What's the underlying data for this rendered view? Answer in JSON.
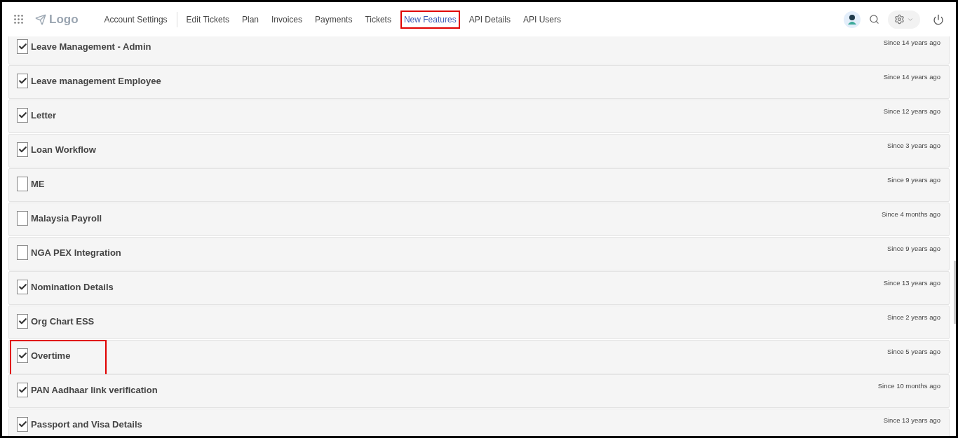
{
  "header": {
    "logo": "Logo",
    "nav": [
      {
        "label": "Account Settings",
        "selected": false,
        "highlighted": false
      },
      {
        "label": "Edit Tickets",
        "selected": false,
        "highlighted": false
      },
      {
        "label": "Plan",
        "selected": false,
        "highlighted": false
      },
      {
        "label": "Invoices",
        "selected": false,
        "highlighted": false
      },
      {
        "label": "Payments",
        "selected": false,
        "highlighted": false
      },
      {
        "label": "Tickets",
        "selected": false,
        "highlighted": false
      },
      {
        "label": "New Features",
        "selected": true,
        "highlighted": true
      },
      {
        "label": "API Details",
        "selected": false,
        "highlighted": false
      },
      {
        "label": "API Users",
        "selected": false,
        "highlighted": false
      }
    ]
  },
  "features": [
    {
      "name": "Leave Management - Admin",
      "since": "Since 14 years ago",
      "checked": true,
      "highlighted": false
    },
    {
      "name": "Leave management Employee",
      "since": "Since 14 years ago",
      "checked": true,
      "highlighted": false
    },
    {
      "name": "Letter",
      "since": "Since 12 years ago",
      "checked": true,
      "highlighted": false
    },
    {
      "name": "Loan Workflow",
      "since": "Since 3 years ago",
      "checked": true,
      "highlighted": false
    },
    {
      "name": "ME",
      "since": "Since 9 years ago",
      "checked": false,
      "highlighted": false
    },
    {
      "name": "Malaysia Payroll",
      "since": "Since 4 months ago",
      "checked": false,
      "highlighted": false
    },
    {
      "name": "NGA PEX Integration",
      "since": "Since 9 years ago",
      "checked": false,
      "highlighted": false
    },
    {
      "name": "Nomination Details",
      "since": "Since 13 years ago",
      "checked": true,
      "highlighted": false
    },
    {
      "name": "Org Chart ESS",
      "since": "Since 2 years ago",
      "checked": true,
      "highlighted": false
    },
    {
      "name": "Overtime",
      "since": "Since 5 years ago",
      "checked": true,
      "highlighted": true
    },
    {
      "name": "PAN Aadhaar link verification",
      "since": "Since 10 months ago",
      "checked": true,
      "highlighted": false
    },
    {
      "name": "Passport and Visa Details",
      "since": "Since 13 years ago",
      "checked": true,
      "highlighted": false
    }
  ]
}
